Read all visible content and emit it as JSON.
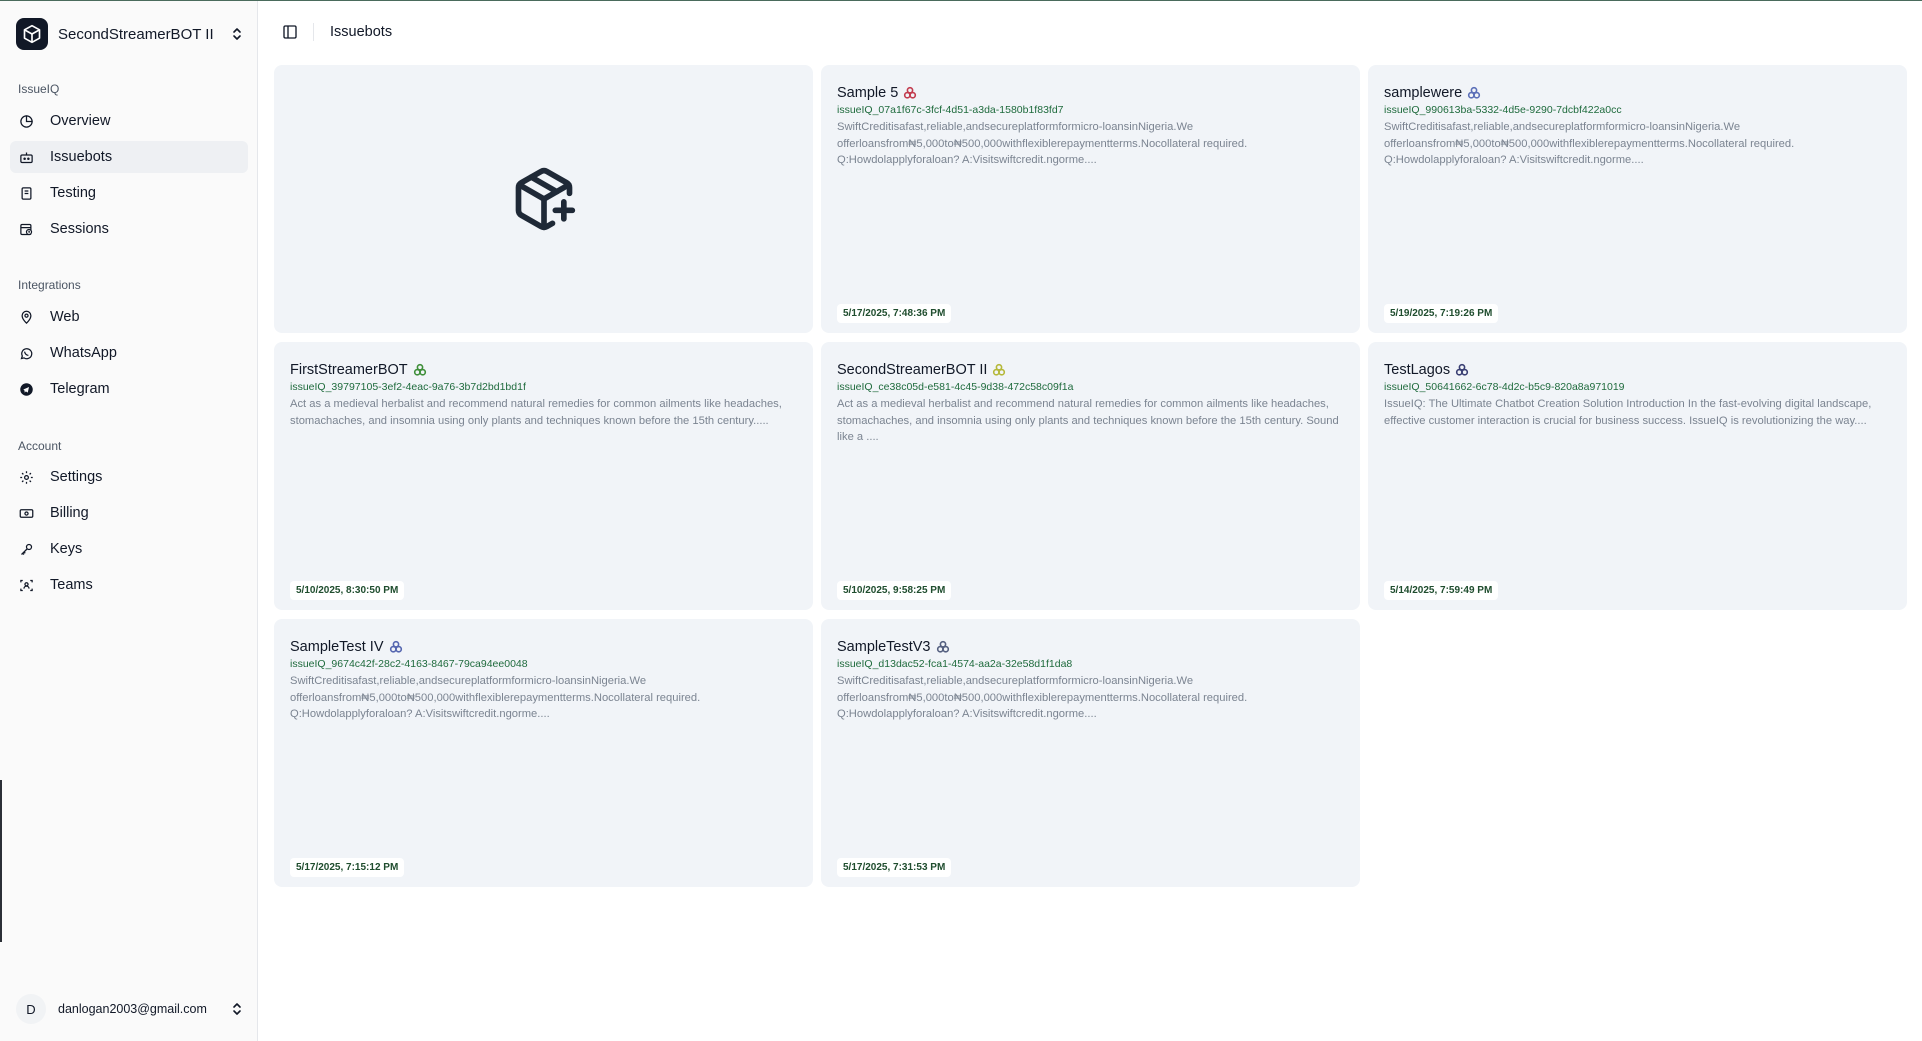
{
  "sidebar": {
    "org_name": "SecondStreamerBOT II",
    "groups": [
      {
        "label": "IssueIQ"
      },
      {
        "label": "Integrations"
      },
      {
        "label": "Account"
      }
    ],
    "items": [
      {
        "label": "Overview",
        "icon": "pie-chart-icon"
      },
      {
        "label": "Issuebots",
        "icon": "bot-icon"
      },
      {
        "label": "Testing",
        "icon": "clipboard-icon"
      },
      {
        "label": "Sessions",
        "icon": "calendar-clock-icon"
      },
      {
        "label": "Web",
        "icon": "location-pin-icon"
      },
      {
        "label": "WhatsApp",
        "icon": "whatsapp-icon"
      },
      {
        "label": "Telegram",
        "icon": "telegram-icon"
      },
      {
        "label": "Settings",
        "icon": "gear-icon"
      },
      {
        "label": "Billing",
        "icon": "banknote-icon"
      },
      {
        "label": "Keys",
        "icon": "key-icon"
      },
      {
        "label": "Teams",
        "icon": "team-icon"
      }
    ],
    "user": {
      "initial": "D",
      "email": "danlogan2003@gmail.com"
    }
  },
  "header": {
    "title": "Issuebots"
  },
  "colors": {
    "id_green": "#1f6b3d",
    "card_bg": "#f1f4f8"
  },
  "bots": [
    {
      "name": "Sample 5",
      "icon_color": "#c23b4e",
      "id": "issueIQ_07a1f67c-3fcf-4d51-a3da-1580b1f83fd7",
      "desc": "SwiftCreditisafast,reliable,andsecureplatformformicro-loansinNigeria.We offerloansfrom₦5,000to₦500,000withflexiblerepaymentterms.Nocollateral required. Q:Howdolapplyforaloan? A:Visitswiftcredit.ngorme....",
      "date": "5/17/2025, 7:48:36 PM"
    },
    {
      "name": "samplewere",
      "icon_color": "#5b6fb8",
      "id": "issueIQ_990613ba-5332-4d5e-9290-7dcbf422a0cc",
      "desc": "SwiftCreditisafast,reliable,andsecureplatformformicro-loansinNigeria.We offerloansfrom₦5,000to₦500,000withflexiblerepaymentterms.Nocollateral required. Q:Howdolapplyforaloan? A:Visitswiftcredit.ngorme....",
      "date": "5/19/2025, 7:19:26 PM"
    },
    {
      "name": "FirstStreamerBOT",
      "icon_color": "#3f8f3a",
      "id": "issueIQ_39797105-3ef2-4eac-9a76-3b7d2bd1bd1f",
      "desc": "Act as a medieval herbalist and recommend natural remedies for common ailments like headaches, stomachaches, and insomnia using only plants and techniques known before the 15th century.....",
      "date": "5/10/2025, 8:30:50 PM"
    },
    {
      "name": "SecondStreamerBOT II",
      "icon_color": "#b5b83a",
      "id": "issueIQ_ce38c05d-e581-4c45-9d38-472c58c09f1a",
      "desc": "Act as a medieval herbalist and recommend natural remedies for common ailments like headaches, stomachaches, and insomnia using only plants and techniques known before the 15th century. Sound like a ....",
      "date": "5/10/2025, 9:58:25 PM"
    },
    {
      "name": "TestLagos",
      "icon_color": "#3a3f73",
      "id": "issueIQ_50641662-6c78-4d2c-b5c9-820a8a971019",
      "desc": "IssueIQ: The Ultimate Chatbot Creation Solution Introduction In the fast-evolving digital landscape, effective customer interaction is crucial for business success. IssueIQ is revolutionizing the way....",
      "date": "5/14/2025, 7:59:49 PM"
    },
    {
      "name": "SampleTest IV",
      "icon_color": "#5566b0",
      "id": "issueIQ_9674c42f-28c2-4163-8467-79ca94ee0048",
      "desc": "SwiftCreditisafast,reliable,andsecureplatformformicro-loansinNigeria.We offerloansfrom₦5,000to₦500,000withflexiblerepaymentterms.Nocollateral required. Q:Howdolapplyforaloan? A:Visitswiftcredit.ngorme....",
      "date": "5/17/2025, 7:15:12 PM"
    },
    {
      "name": "SampleTestV3",
      "icon_color": "#556080",
      "id": "issueIQ_d13dac52-fca1-4574-aa2a-32e58d1f1da8",
      "desc": "SwiftCreditisafast,reliable,andsecureplatformformicro-loansinNigeria.We offerloansfrom₦5,000to₦500,000withflexiblerepaymentterms.Nocollateral required. Q:Howdolapplyforaloan? A:Visitswiftcredit.ngorme....",
      "date": "5/17/2025, 7:31:53 PM"
    }
  ]
}
